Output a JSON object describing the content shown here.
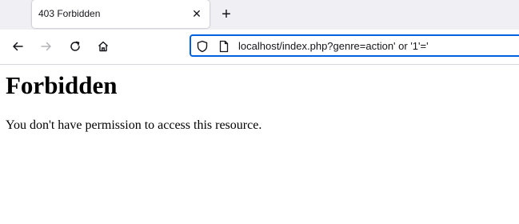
{
  "tab": {
    "title": "403 Forbidden",
    "close_glyph": "✕"
  },
  "newtab_glyph": "+",
  "toolbar": {
    "back_icon": "back-arrow-icon",
    "forward_icon": "forward-arrow-icon",
    "reload_icon": "reload-icon",
    "home_icon": "home-icon"
  },
  "urlbar": {
    "value": "localhost/index.php?genre=action' or '1'='",
    "focus_color": "#0061e0"
  },
  "page": {
    "heading": "Forbidden",
    "message": "You don't have permission to access this resource."
  }
}
